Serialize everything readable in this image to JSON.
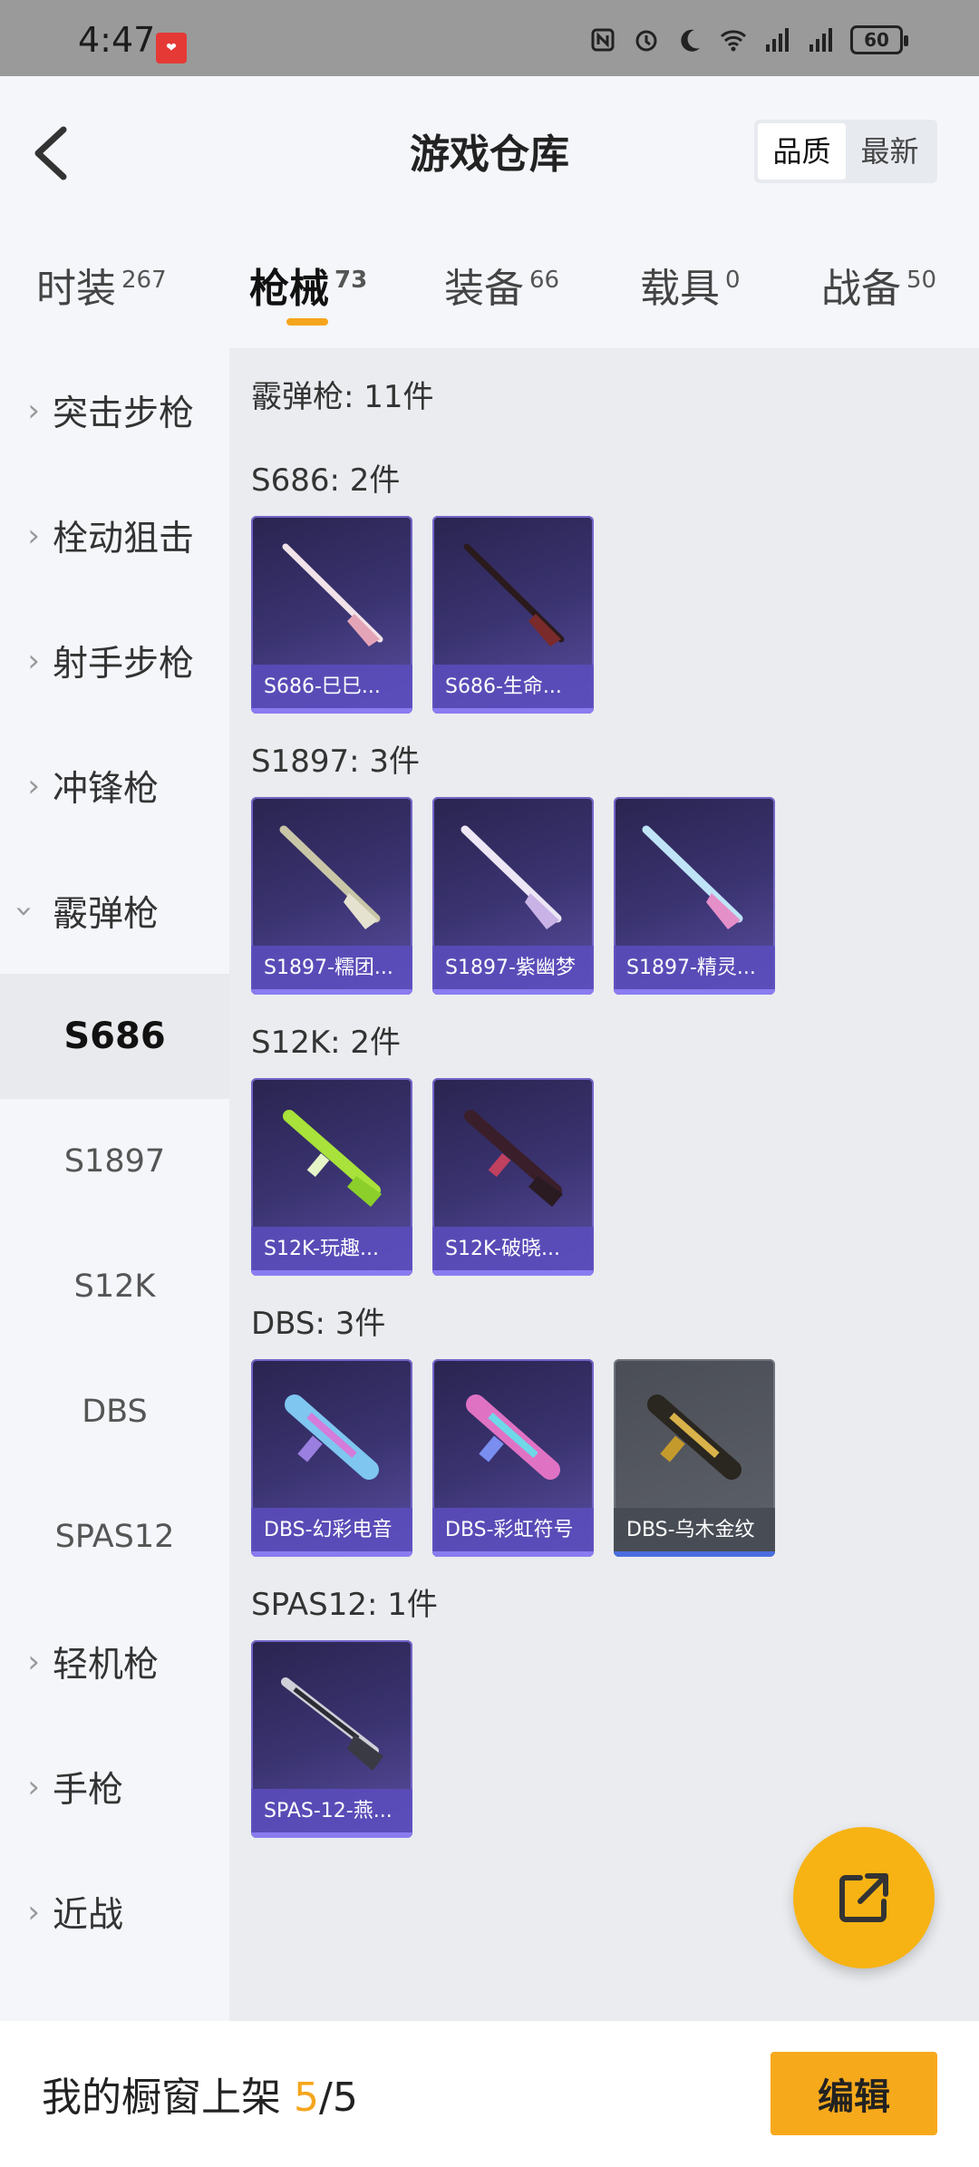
{
  "status_bar": {
    "time": "4:47",
    "battery": "60"
  },
  "header": {
    "title": "游戏仓库",
    "sort_options": [
      "品质",
      "最新"
    ],
    "sort_selected": "品质"
  },
  "tabs": [
    {
      "label": "时装",
      "count": "267"
    },
    {
      "label": "枪械",
      "count": "73",
      "active": true
    },
    {
      "label": "装备",
      "count": "66"
    },
    {
      "label": "载具",
      "count": "0"
    },
    {
      "label": "战备",
      "count": "50"
    }
  ],
  "sidebar": {
    "categories": [
      "突击步枪",
      "栓动狙击",
      "射手步枪",
      "冲锋枪",
      "霰弹枪"
    ],
    "expanded_category": "霰弹枪",
    "subitems": [
      "S686",
      "S1897",
      "S12K",
      "DBS",
      "SPAS12"
    ],
    "active_subitem": "S686",
    "more_categories": [
      "轻机枪",
      "手枪",
      "近战"
    ]
  },
  "content": {
    "summary": "霰弹枪: 11件",
    "groups": [
      {
        "title": "S686: 2件",
        "items": [
          "S686-巳巳...",
          "S686-生命..."
        ]
      },
      {
        "title": "S1897: 3件",
        "items": [
          "S1897-糯团...",
          "S1897-紫幽梦",
          "S1897-精灵..."
        ]
      },
      {
        "title": "S12K: 2件",
        "items": [
          "S12K-玩趣...",
          "S12K-破晓..."
        ]
      },
      {
        "title": "DBS: 3件",
        "items": [
          "DBS-幻彩电音",
          "DBS-彩虹符号",
          "DBS-乌木金纹"
        ]
      },
      {
        "title": "SPAS12: 1件",
        "items": [
          "SPAS-12-燕..."
        ]
      }
    ]
  },
  "bottom_bar": {
    "label": "我的橱窗上架",
    "current": "5",
    "total": "/5",
    "edit_button": "编辑"
  },
  "colors": {
    "accent": "#f5a51d",
    "item_bg": "#3a3370",
    "item_caption": "#5c4ebe"
  }
}
